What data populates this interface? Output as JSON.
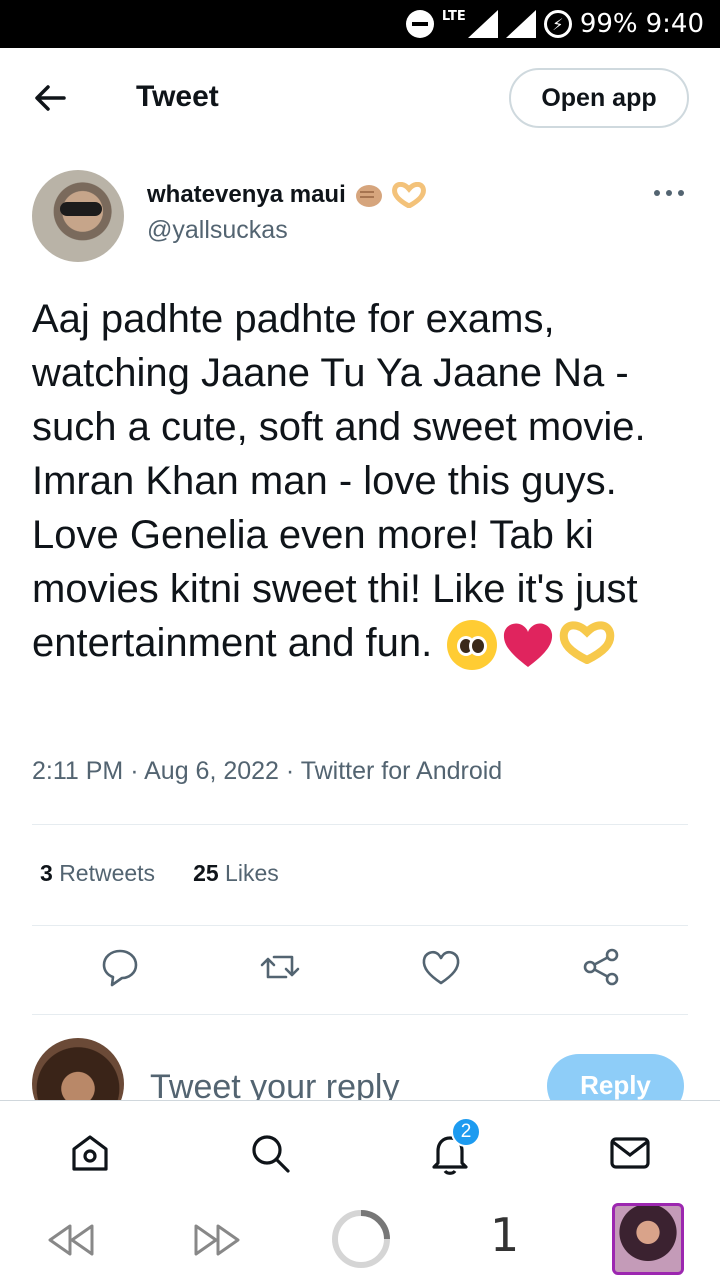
{
  "status_bar": {
    "network": "LTE",
    "battery": "99%",
    "time": "9:40"
  },
  "header": {
    "title": "Tweet",
    "open_app_label": "Open app"
  },
  "author": {
    "name": "whatevenya maui",
    "handle": "@yallsuckas",
    "name_emojis": [
      "fist-bump-emoji",
      "heart-hands-emoji"
    ]
  },
  "tweet": {
    "text": "Aaj padhte padhte for exams, watching Jaane Tu Ya Jaane Na - such a cute, soft and sweet movie. Imran Khan man - love this guys. Love Genelia even more! Tab ki movies kitni sweet thi! Like it's just entertainment and fun.",
    "emojis": [
      "pleading-face-emoji",
      "red-heart-emoji",
      "heart-hands-emoji"
    ],
    "time": "2:11 PM",
    "date": "Aug 6, 2022",
    "source": "Twitter for Android",
    "separator": "·"
  },
  "stats": {
    "retweets_count": "3",
    "retweets_label": "Retweets",
    "likes_count": "25",
    "likes_label": "Likes"
  },
  "actions": [
    "reply-icon",
    "retweet-icon",
    "like-icon",
    "share-icon"
  ],
  "reply_bar": {
    "placeholder": "Tweet your reply",
    "button_label": "Reply"
  },
  "bottom_nav": {
    "items": [
      "home-icon",
      "search-icon",
      "notifications-icon",
      "messages-icon"
    ],
    "notification_badge": "2"
  },
  "system_bar": {
    "tab_count": "1"
  },
  "colors": {
    "accent": "#1d9bf0",
    "reply_button": "#8ecdf8",
    "secondary_text": "#536471",
    "heart": "#e0245e"
  }
}
